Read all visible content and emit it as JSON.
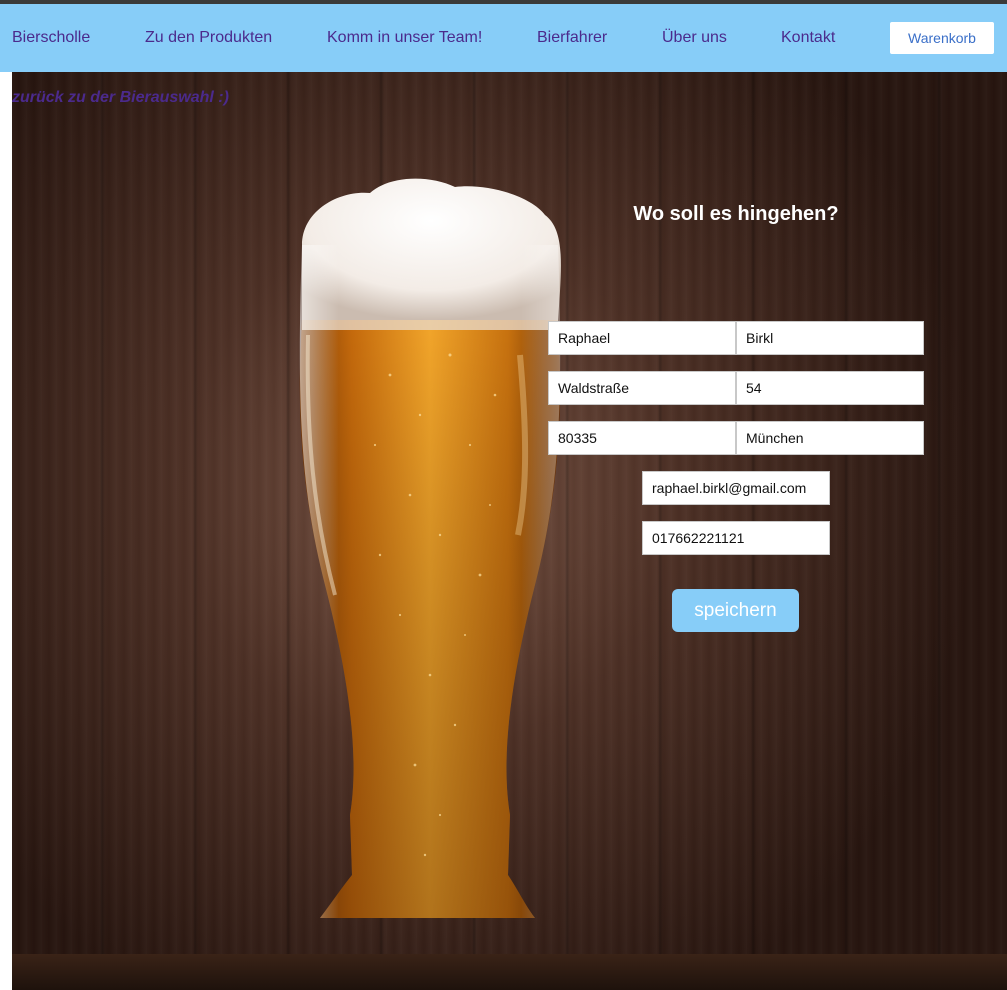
{
  "nav": {
    "brand": "Bierscholle",
    "items": [
      "Zu den Produkten",
      "Komm in unser Team!",
      "Bierfahrer",
      "Über uns",
      "Kontakt"
    ],
    "cart_label": "Warenkorb"
  },
  "back_link": "zurück zu der Bierauswahl :)",
  "form": {
    "title": "Wo soll es hingehen?",
    "firstname": "Raphael",
    "lastname": "Birkl",
    "street": "Waldstraße",
    "house_number": "54",
    "zip": "80335",
    "city": "München",
    "email": "raphael.birkl@gmail.com",
    "phone": "017662221121",
    "save_label": "speichern"
  },
  "colors": {
    "nav_background": "#87cdf8",
    "nav_text": "#4b2a8c",
    "cart_text": "#3a6fc8",
    "button_background": "#87cdf8",
    "title_text": "#ffffff"
  }
}
